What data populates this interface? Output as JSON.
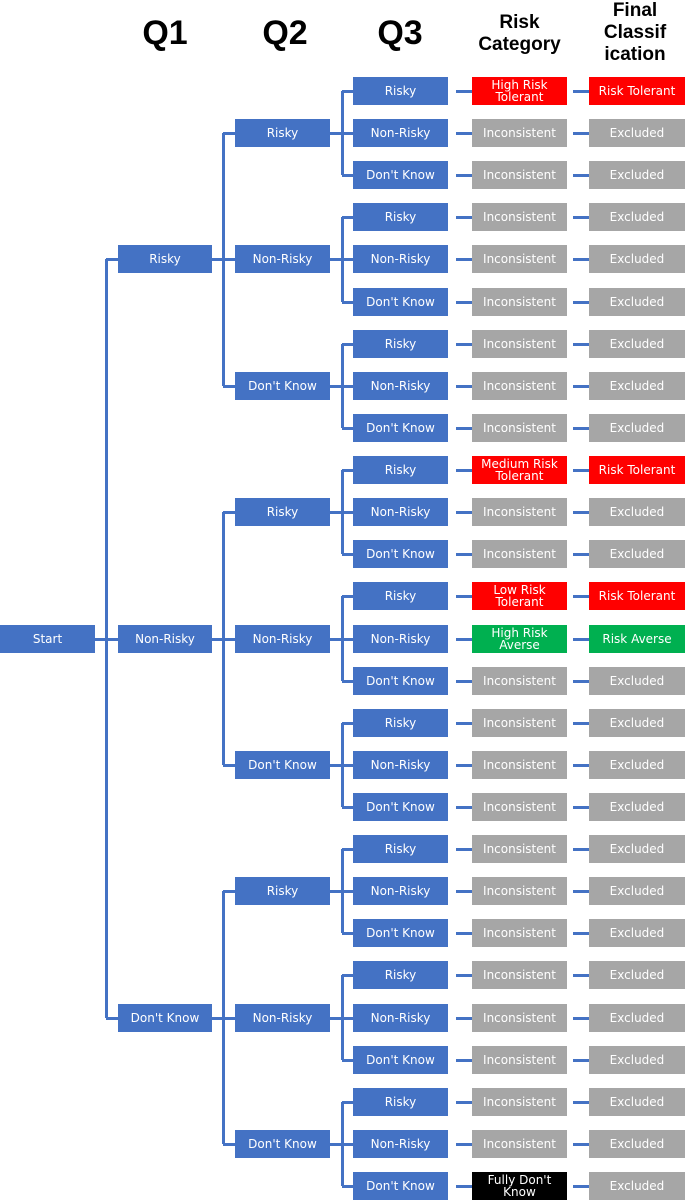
{
  "headers": {
    "q1": "Q1",
    "q2": "Q2",
    "q3": "Q3",
    "risk_category": [
      "Risk",
      "Category"
    ],
    "final_classification": [
      "Final",
      "Classif",
      "ication"
    ]
  },
  "colors": {
    "node": "#4472c4",
    "tolerant": "#ff0000",
    "averse": "#00b050",
    "inconsistent": "#a6a6a6",
    "dont_know": "#000000",
    "connector": "#4472c4"
  },
  "start": "Start",
  "answers": [
    "Risky",
    "Non-Risky",
    "Don't Know"
  ],
  "outcomes": [
    {
      "q1": "Risky",
      "q2": "Risky",
      "q3": "Risky",
      "risk": "High Risk Tolerant",
      "risk_color": "tolerant",
      "final": "Risk Tolerant",
      "final_color": "tolerant"
    },
    {
      "q1": "Risky",
      "q2": "Risky",
      "q3": "Non-Risky",
      "risk": "Inconsistent",
      "risk_color": "inconsistent",
      "final": "Excluded",
      "final_color": "inconsistent"
    },
    {
      "q1": "Risky",
      "q2": "Risky",
      "q3": "Don't Know",
      "risk": "Inconsistent",
      "risk_color": "inconsistent",
      "final": "Excluded",
      "final_color": "inconsistent"
    },
    {
      "q1": "Risky",
      "q2": "Non-Risky",
      "q3": "Risky",
      "risk": "Inconsistent",
      "risk_color": "inconsistent",
      "final": "Excluded",
      "final_color": "inconsistent"
    },
    {
      "q1": "Risky",
      "q2": "Non-Risky",
      "q3": "Non-Risky",
      "risk": "Inconsistent",
      "risk_color": "inconsistent",
      "final": "Excluded",
      "final_color": "inconsistent"
    },
    {
      "q1": "Risky",
      "q2": "Non-Risky",
      "q3": "Don't Know",
      "risk": "Inconsistent",
      "risk_color": "inconsistent",
      "final": "Excluded",
      "final_color": "inconsistent"
    },
    {
      "q1": "Risky",
      "q2": "Don't Know",
      "q3": "Risky",
      "risk": "Inconsistent",
      "risk_color": "inconsistent",
      "final": "Excluded",
      "final_color": "inconsistent"
    },
    {
      "q1": "Risky",
      "q2": "Don't Know",
      "q3": "Non-Risky",
      "risk": "Inconsistent",
      "risk_color": "inconsistent",
      "final": "Excluded",
      "final_color": "inconsistent"
    },
    {
      "q1": "Risky",
      "q2": "Don't Know",
      "q3": "Don't Know",
      "risk": "Inconsistent",
      "risk_color": "inconsistent",
      "final": "Excluded",
      "final_color": "inconsistent"
    },
    {
      "q1": "Non-Risky",
      "q2": "Risky",
      "q3": "Risky",
      "risk": "Medium Risk Tolerant",
      "risk_color": "tolerant",
      "final": "Risk Tolerant",
      "final_color": "tolerant"
    },
    {
      "q1": "Non-Risky",
      "q2": "Risky",
      "q3": "Non-Risky",
      "risk": "Inconsistent",
      "risk_color": "inconsistent",
      "final": "Excluded",
      "final_color": "inconsistent"
    },
    {
      "q1": "Non-Risky",
      "q2": "Risky",
      "q3": "Don't Know",
      "risk": "Inconsistent",
      "risk_color": "inconsistent",
      "final": "Excluded",
      "final_color": "inconsistent"
    },
    {
      "q1": "Non-Risky",
      "q2": "Non-Risky",
      "q3": "Risky",
      "risk": "Low Risk Tolerant",
      "risk_color": "tolerant",
      "final": "Risk Tolerant",
      "final_color": "tolerant"
    },
    {
      "q1": "Non-Risky",
      "q2": "Non-Risky",
      "q3": "Non-Risky",
      "risk": "High Risk Averse",
      "risk_color": "averse",
      "final": "Risk Averse",
      "final_color": "averse"
    },
    {
      "q1": "Non-Risky",
      "q2": "Non-Risky",
      "q3": "Don't Know",
      "risk": "Inconsistent",
      "risk_color": "inconsistent",
      "final": "Excluded",
      "final_color": "inconsistent"
    },
    {
      "q1": "Non-Risky",
      "q2": "Don't Know",
      "q3": "Risky",
      "risk": "Inconsistent",
      "risk_color": "inconsistent",
      "final": "Excluded",
      "final_color": "inconsistent"
    },
    {
      "q1": "Non-Risky",
      "q2": "Don't Know",
      "q3": "Non-Risky",
      "risk": "Inconsistent",
      "risk_color": "inconsistent",
      "final": "Excluded",
      "final_color": "inconsistent"
    },
    {
      "q1": "Non-Risky",
      "q2": "Don't Know",
      "q3": "Don't Know",
      "risk": "Inconsistent",
      "risk_color": "inconsistent",
      "final": "Excluded",
      "final_color": "inconsistent"
    },
    {
      "q1": "Don't Know",
      "q2": "Risky",
      "q3": "Risky",
      "risk": "Inconsistent",
      "risk_color": "inconsistent",
      "final": "Excluded",
      "final_color": "inconsistent"
    },
    {
      "q1": "Don't Know",
      "q2": "Risky",
      "q3": "Non-Risky",
      "risk": "Inconsistent",
      "risk_color": "inconsistent",
      "final": "Excluded",
      "final_color": "inconsistent"
    },
    {
      "q1": "Don't Know",
      "q2": "Risky",
      "q3": "Don't Know",
      "risk": "Inconsistent",
      "risk_color": "inconsistent",
      "final": "Excluded",
      "final_color": "inconsistent"
    },
    {
      "q1": "Don't Know",
      "q2": "Non-Risky",
      "q3": "Risky",
      "risk": "Inconsistent",
      "risk_color": "inconsistent",
      "final": "Excluded",
      "final_color": "inconsistent"
    },
    {
      "q1": "Don't Know",
      "q2": "Non-Risky",
      "q3": "Non-Risky",
      "risk": "Inconsistent",
      "risk_color": "inconsistent",
      "final": "Excluded",
      "final_color": "inconsistent"
    },
    {
      "q1": "Don't Know",
      "q2": "Non-Risky",
      "q3": "Don't Know",
      "risk": "Inconsistent",
      "risk_color": "inconsistent",
      "final": "Excluded",
      "final_color": "inconsistent"
    },
    {
      "q1": "Don't Know",
      "q2": "Don't Know",
      "q3": "Risky",
      "risk": "Inconsistent",
      "risk_color": "inconsistent",
      "final": "Excluded",
      "final_color": "inconsistent"
    },
    {
      "q1": "Don't Know",
      "q2": "Don't Know",
      "q3": "Non-Risky",
      "risk": "Inconsistent",
      "risk_color": "inconsistent",
      "final": "Excluded",
      "final_color": "inconsistent"
    },
    {
      "q1": "Don't Know",
      "q2": "Don't Know",
      "q3": "Don't Know",
      "risk": "Fully Don't Know",
      "risk_color": "dont_know",
      "final": "Excluded",
      "final_color": "inconsistent"
    }
  ]
}
